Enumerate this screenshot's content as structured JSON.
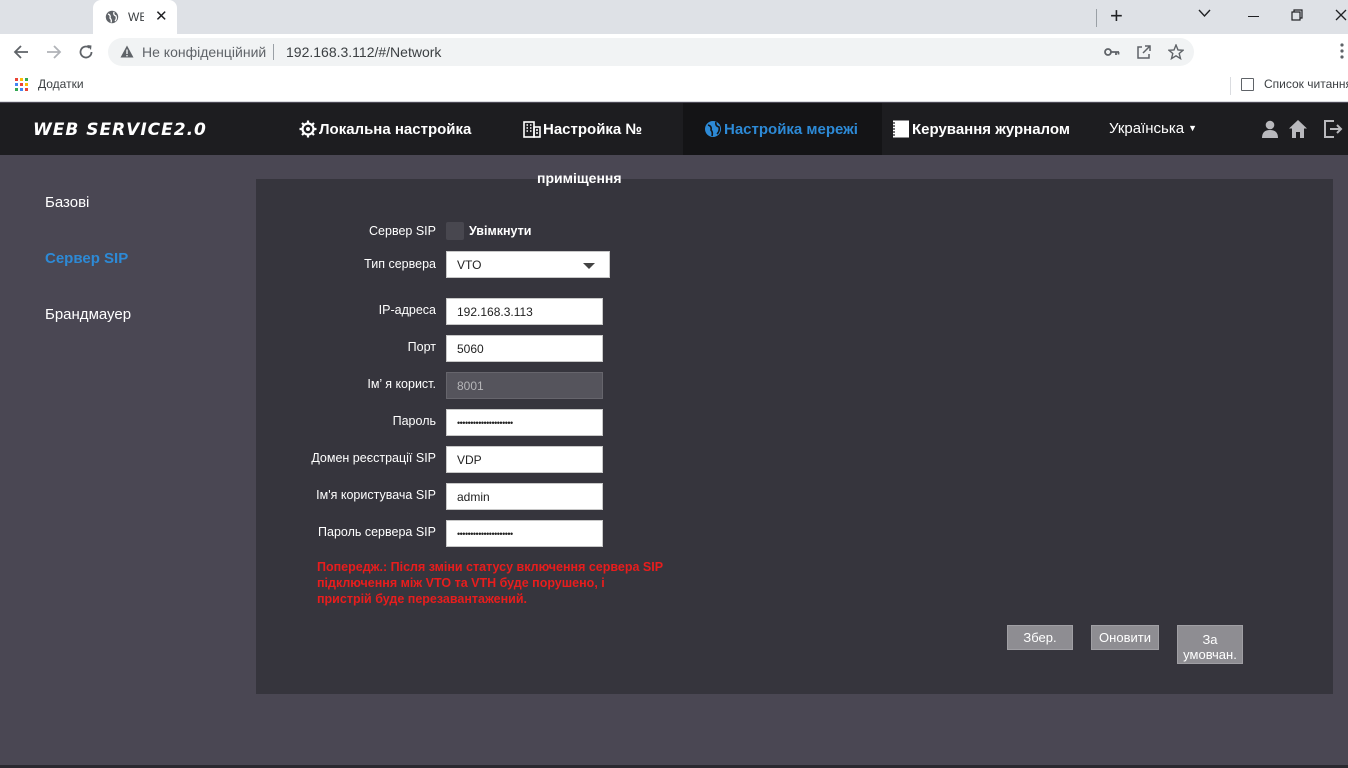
{
  "browser": {
    "tab_title": "WEB",
    "tab_close": "✕",
    "new_tab": "+",
    "security_text": "Не конфіденційний",
    "url": "192.168.3.112/#/Network",
    "bookmarks_label": "Додатки",
    "reading_list_label": "Список читання"
  },
  "app": {
    "logo": "WEB SERVICE2.0",
    "nav": [
      {
        "label": "Локальна настройка",
        "icon": "gear-icon"
      },
      {
        "label": "Настройка №",
        "icon": "building-icon"
      },
      {
        "label": "Настройка мережі",
        "icon": "globe-icon"
      },
      {
        "label": "Керування журналом",
        "icon": "log-icon"
      }
    ],
    "nav_continuation": "приміщення",
    "language": "Українська",
    "accent_color": "#2d8ad6"
  },
  "sidebar": {
    "items": [
      {
        "label": "Базові"
      },
      {
        "label": "Сервер SIP"
      },
      {
        "label": "Брандмауер"
      }
    ]
  },
  "form": {
    "sip_server_label": "Сервер SIP",
    "enable_label": "Увімкнути",
    "server_type_label": "Тип сервера",
    "server_type_value": "VTO",
    "ip_label": "IP-адреса",
    "ip_value": "192.168.3.113",
    "port_label": "Порт",
    "port_value": "5060",
    "username_label": "Ім’ я корист.",
    "username_value": "8001",
    "password_label": "Пароль",
    "password_value": "•••••••••••••••••••••",
    "domain_label": "Домен реєстрації SIP",
    "domain_value": "VDP",
    "sip_user_label": "Ім'я користувача SIP",
    "sip_user_value": "admin",
    "sip_password_label": "Пароль сервера SIP",
    "sip_password_value": "•••••••••••••••••••••",
    "warning_lines": [
      "Попередж.: Після зміни статусу включення сервера SIP",
      "підключення між VTO та VTH буде порушено, і",
      "пристрій буде перезавантажений."
    ],
    "warning_color": "#e81d1d"
  },
  "buttons": {
    "save": "Збер.",
    "refresh": "Оновити",
    "default_line1": "За",
    "default_line2": "умовчан."
  }
}
